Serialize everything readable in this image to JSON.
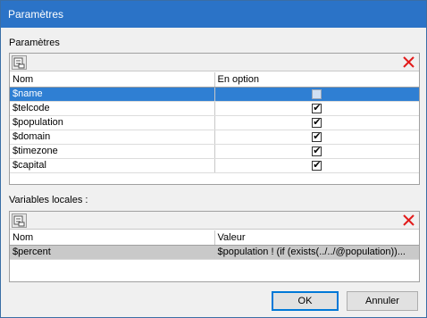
{
  "window": {
    "title": "Paramètres"
  },
  "parameters": {
    "section_label": "Paramètres",
    "columns": {
      "name": "Nom",
      "optional": "En option"
    },
    "rows": [
      {
        "name": "$name",
        "optional": false,
        "selected": true
      },
      {
        "name": "$telcode",
        "optional": true
      },
      {
        "name": "$population",
        "optional": true
      },
      {
        "name": "$domain",
        "optional": true
      },
      {
        "name": "$timezone",
        "optional": true
      },
      {
        "name": "$capital",
        "optional": true
      }
    ]
  },
  "locals": {
    "section_label": "Variables locales :",
    "columns": {
      "name": "Nom",
      "value": "Valeur"
    },
    "rows": [
      {
        "name": "$percent",
        "value": "$population ! (if (exists(../../@population))..."
      }
    ]
  },
  "buttons": {
    "ok": "OK",
    "cancel": "Annuler"
  },
  "icons": {
    "add": "add-row-icon",
    "delete": "delete-x-icon"
  },
  "colors": {
    "title_bar": "#2b73c7",
    "selection": "#2f7fd3",
    "delete_icon": "#e21b1b"
  }
}
